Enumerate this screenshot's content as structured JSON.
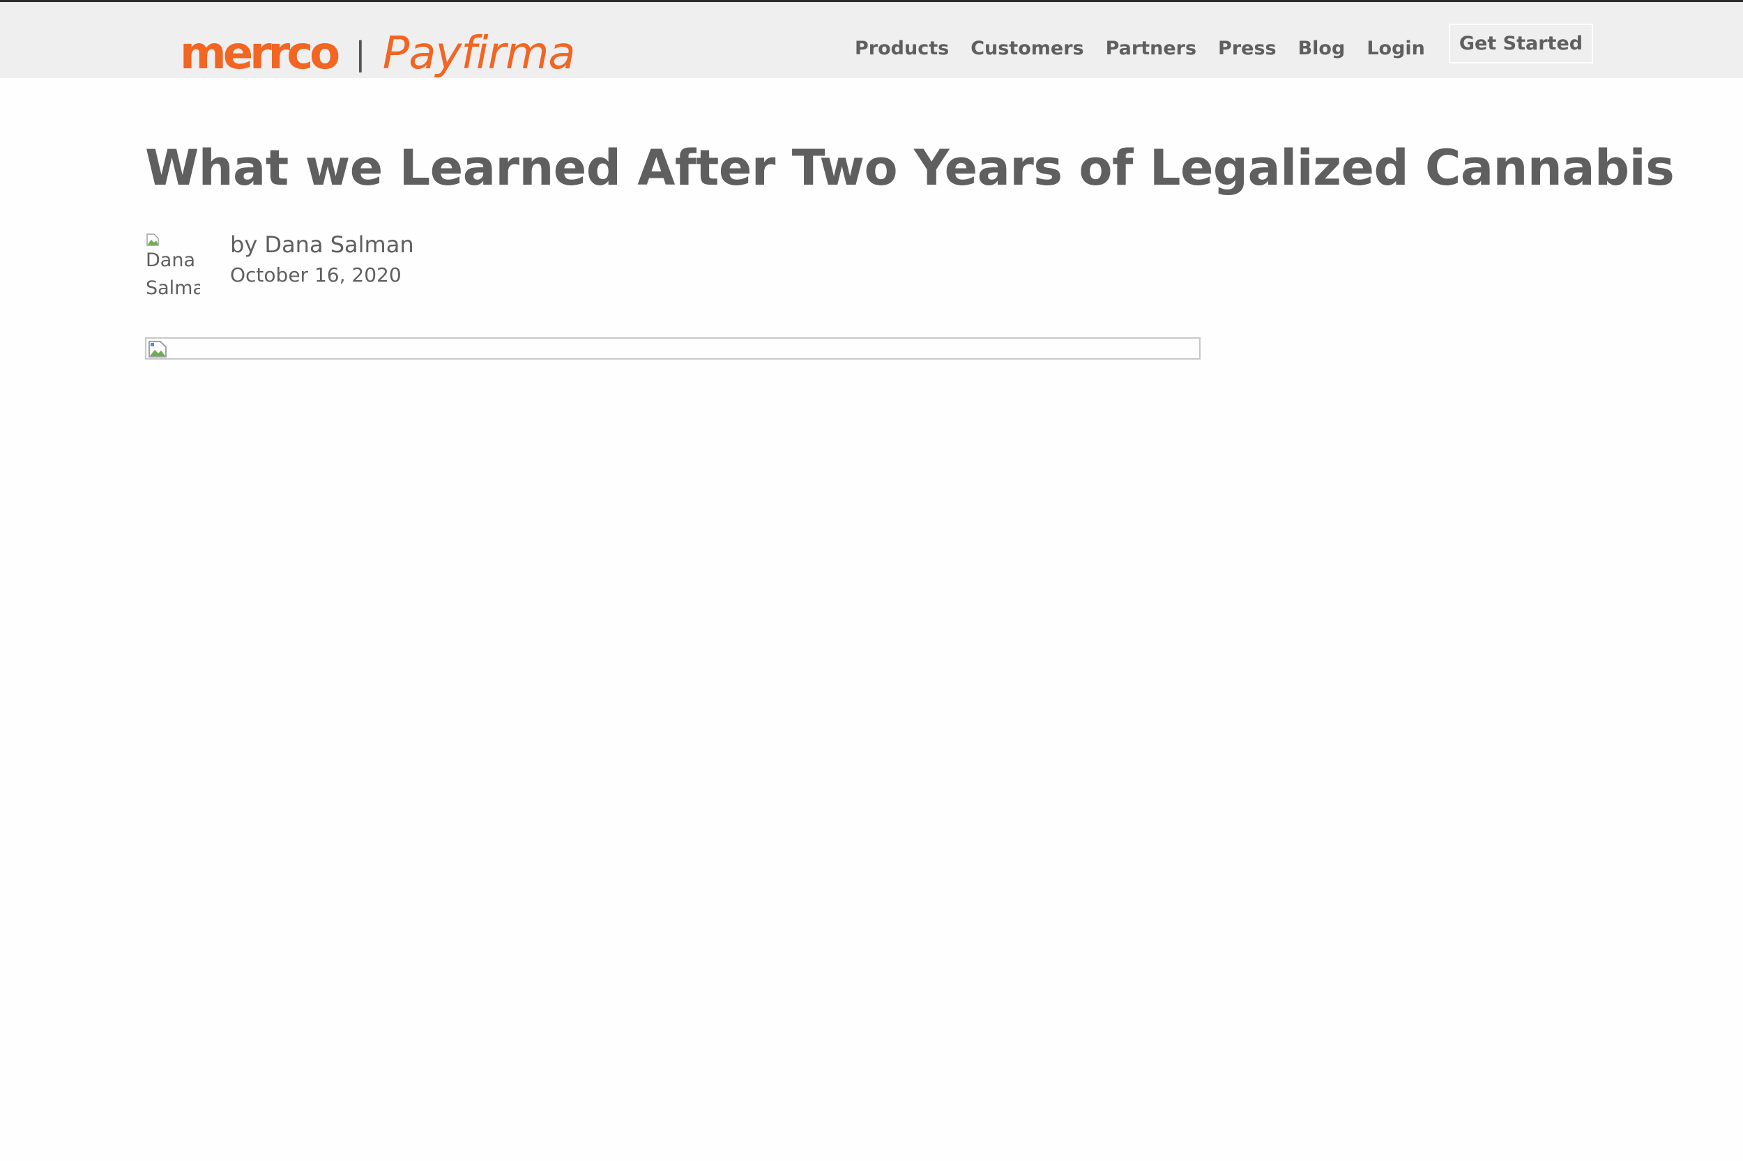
{
  "brand": {
    "primary": "merrco",
    "separator": "|",
    "secondary": "Payfirma",
    "color": "#f26522"
  },
  "nav": {
    "items": [
      {
        "label": "Products",
        "name": "products"
      },
      {
        "label": "Customers",
        "name": "customers"
      },
      {
        "label": "Partners",
        "name": "partners"
      },
      {
        "label": "Press",
        "name": "press"
      },
      {
        "label": "Blog",
        "name": "blog"
      },
      {
        "label": "Login",
        "name": "login"
      }
    ],
    "cta_label": "Get Started"
  },
  "article": {
    "title": "What we Learned After Two Years of Legalized Cannabis",
    "author_avatar_alt": "Dana Salman",
    "byline": "by Dana Salman",
    "date": "October 16, 2020"
  },
  "icons": {
    "broken_image": "broken-image-icon"
  }
}
